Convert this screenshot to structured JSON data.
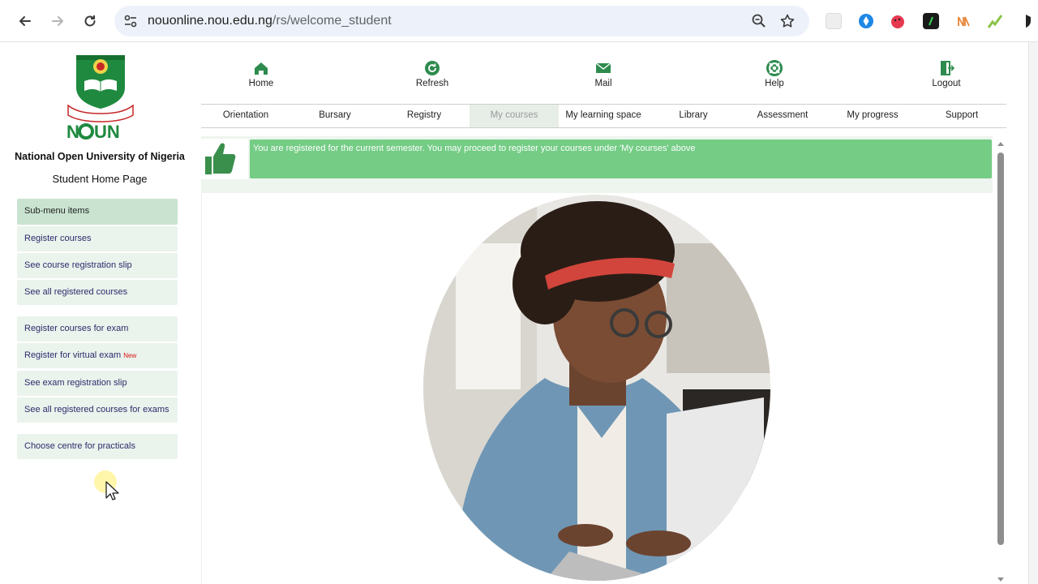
{
  "browser": {
    "url_host": "nouonline.nou.edu.ng",
    "url_path": "/rs/welcome_student",
    "back_icon": "arrow-left-icon",
    "forward_icon": "arrow-right-icon",
    "reload_icon": "reload-icon",
    "zoom_icon": "zoom-icon",
    "bookmark_icon": "star-icon"
  },
  "sidebar": {
    "university_name": "National Open University of Nigeria",
    "page_subtitle": "Student Home Page",
    "submenu_header": "Sub-menu items",
    "group1": [
      {
        "label": "Register courses"
      },
      {
        "label": "See course registration slip"
      },
      {
        "label": "See all registered courses"
      }
    ],
    "group2": [
      {
        "label": "Register courses for exam"
      },
      {
        "label": "Register for virtual exam",
        "badge": "New"
      },
      {
        "label": "See exam registration slip"
      },
      {
        "label": "See all registered courses for exams"
      }
    ],
    "group3": [
      {
        "label": "Choose centre for practicals"
      }
    ]
  },
  "top_nav": [
    {
      "label": "Home",
      "icon": "home-icon"
    },
    {
      "label": "Refresh",
      "icon": "refresh-icon"
    },
    {
      "label": "Mail",
      "icon": "mail-icon"
    },
    {
      "label": "Help",
      "icon": "help-icon"
    },
    {
      "label": "Logout",
      "icon": "logout-icon"
    }
  ],
  "tabs": [
    {
      "label": "Orientation"
    },
    {
      "label": "Bursary"
    },
    {
      "label": "Registry"
    },
    {
      "label": "My courses",
      "active": true
    },
    {
      "label": "My learning space"
    },
    {
      "label": "Library"
    },
    {
      "label": "Assessment"
    },
    {
      "label": "My progress"
    },
    {
      "label": "Support"
    }
  ],
  "notice": {
    "icon": "thumbs-up-icon",
    "text": "You are registered for the current semester. You may proceed to register your courses under 'My courses' above"
  },
  "colors": {
    "brand_green": "#2e8b4e",
    "notice_green": "#74cc85",
    "menu_bg": "#eaf3ec",
    "menu_header_bg": "#c9e3d0"
  }
}
